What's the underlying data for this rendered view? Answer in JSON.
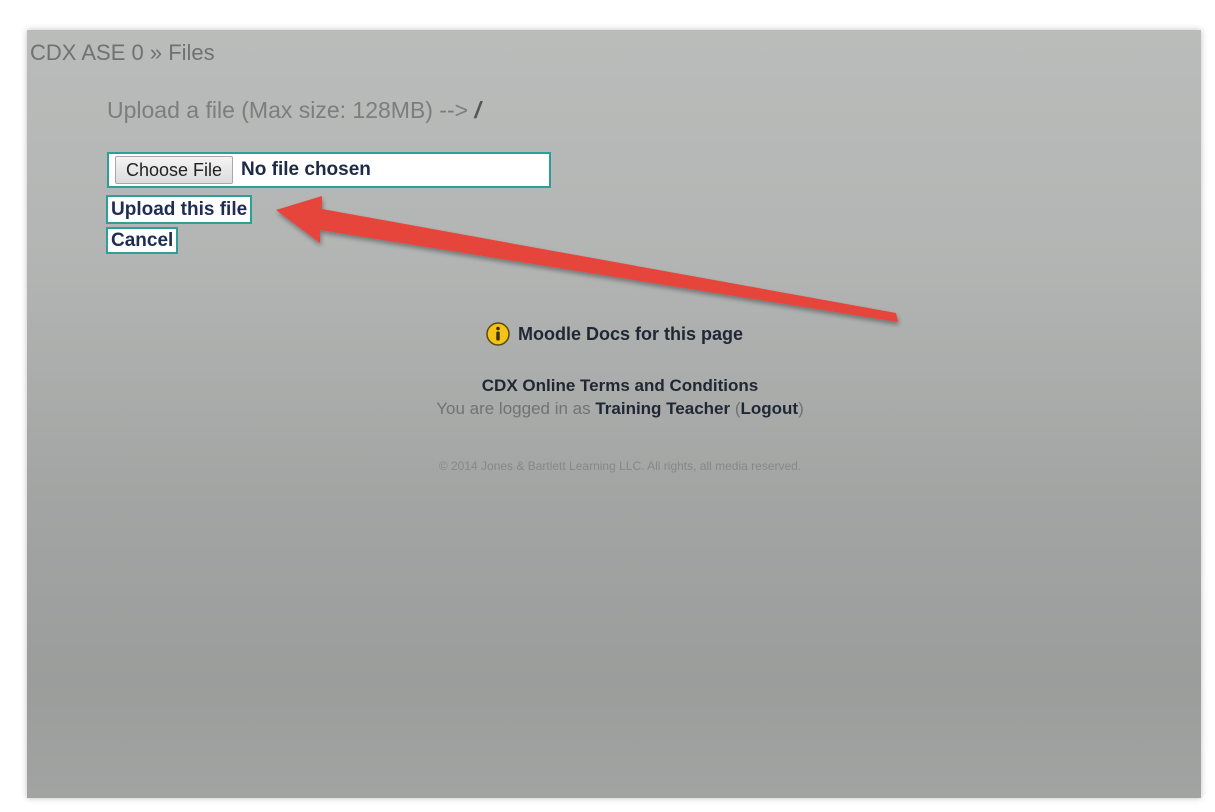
{
  "breadcrumb": {
    "course": "CDX ASE 0",
    "separator": " » ",
    "current": "Files"
  },
  "upload": {
    "heading": "Upload a file (Max size: 128MB) --> ",
    "path": "/",
    "choose_label": "Choose File",
    "no_file_text": "No file chosen",
    "upload_label": "Upload this file",
    "cancel_label": "Cancel"
  },
  "footer": {
    "docs_link": "Moodle Docs for this page",
    "terms_link": "CDX Online Terms and Conditions",
    "logged_prefix": "You are logged in as ",
    "user_name": "Training Teacher",
    "logout_open": " (",
    "logout_label": "Logout",
    "logout_close": ")",
    "copyright": "© 2014 Jones & Bartlett Learning LLC. All rights, all media reserved."
  },
  "icons": {
    "info": "info-icon",
    "annotation": "red-arrow"
  },
  "colors": {
    "accent_border": "#2f9e95",
    "link_text": "#1f2d52",
    "arrow": "#e5443b",
    "info_icon": "#f3c317"
  }
}
